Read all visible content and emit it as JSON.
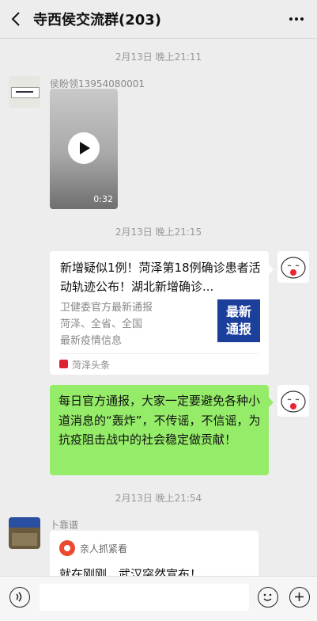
{
  "header": {
    "title": "寺西侯交流群(203)"
  },
  "messages": {
    "time1": "2月13日 晚上21:11",
    "msg1": {
      "sender": "侯盼领13954080001",
      "duration": "0:32"
    },
    "time2": "2月13日 晚上21:15",
    "card": {
      "title": "新增疑似1例！菏泽第18例确诊患者活动轨迹公布！湖北新增确诊...",
      "desc_lines": [
        "卫健委官方最新通报",
        "菏泽、全省、全国",
        "最新疫情信息"
      ],
      "thumb_lines": [
        "最新",
        "通报"
      ],
      "source": "菏泽头条"
    },
    "text_msg": "每日官方通报，大家一定要避免各种小道消息的“轰炸”，不传谣，不信谣，为抗疫阻击战中的社会稳定做贡献！",
    "time3": "2月13日 晚上21:54",
    "msg3": {
      "sender": "卜靠谱",
      "app_name": "亲人抓紧看",
      "text": "就在刚刚，武汉突然宣布！"
    }
  },
  "colors": {
    "self_bubble": "#95ec69",
    "bg": "#ededed"
  }
}
